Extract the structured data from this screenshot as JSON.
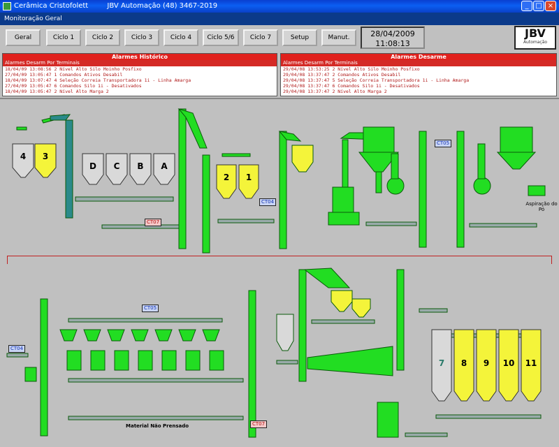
{
  "window": {
    "title": "Cerâmica Cristofolett",
    "subtitle": "JBV Automação (48) 3467-2019",
    "menu": "Monitoração Geral",
    "minimize_symbol": "_",
    "maximize_symbol": "□",
    "close_symbol": "×"
  },
  "toolbar": {
    "buttons": [
      "Geral",
      "Ciclo 1",
      "Ciclo 2",
      "Ciclo 3",
      "Ciclo 4",
      "Ciclo 5/6",
      "Ciclo 7",
      "Setup",
      "Manut."
    ],
    "date": "28/04/2009",
    "time": "11:08:13"
  },
  "logo": {
    "brand": "JBV",
    "tagline": "Automação"
  },
  "alarms_history": {
    "title": "Alarmes Histórico",
    "header": "Alarmes Desarm Por Terminais",
    "rows": [
      "18/04/09 13:08:56   2 Nível Alto Silo Moinho Posfixo",
      "27/04/09 13:05:47   1 Comandos Ativos Desabil",
      "18/04/09 13:07:47   4 Seleção Correia Transportadora 1i - Linha Amarga",
      "27/04/09 13:05:47   6 Comandos Silo 1i - Desativados",
      "18/04/09 13:05:47   2 Nível Alto Marga 2"
    ]
  },
  "alarms_active": {
    "title": "Alarmes Desarme",
    "header": "Alarmes Desarm Por Terminais",
    "rows": [
      "29/04/08 13:53:25   2 Nível Alto Silo Moinho Posfixo",
      "29/04/08 13:37:47   2 Comandos Ativos Desabil",
      "29/04/08 13:37:47   5 Seleção Correia Transportadora 1i - Linha Amarga",
      "29/04/08 13:37:47   6 Comandos Silo 1i - Desativados",
      "29/04/08 13:37:47   2 Nível Alto Marga 2"
    ]
  },
  "plant": {
    "silos_top_left": [
      "4",
      "3"
    ],
    "bins_top": [
      "D",
      "C",
      "B",
      "A"
    ],
    "silos_top_mid": [
      "2",
      "1"
    ],
    "silos_bottom_right": [
      "7",
      "8",
      "9",
      "10",
      "11"
    ],
    "tags": {
      "ct07_top": "CT07",
      "ct04_top": "CT04",
      "ct05_top": "CT05",
      "ct05_bottom": "CT05",
      "ct04_bottom": "CT04",
      "ct07_bottom": "CT07"
    },
    "caption_filter": "Aspiração do Pó",
    "caption_material": "Material Não Prensado"
  },
  "colors": {
    "equipment": "#22dd22",
    "silo_active": "#f4f43a",
    "silo_idle": "#d9d9d9",
    "alarm_red": "#e0201c",
    "elevator_teal": "#2a8a8a"
  }
}
